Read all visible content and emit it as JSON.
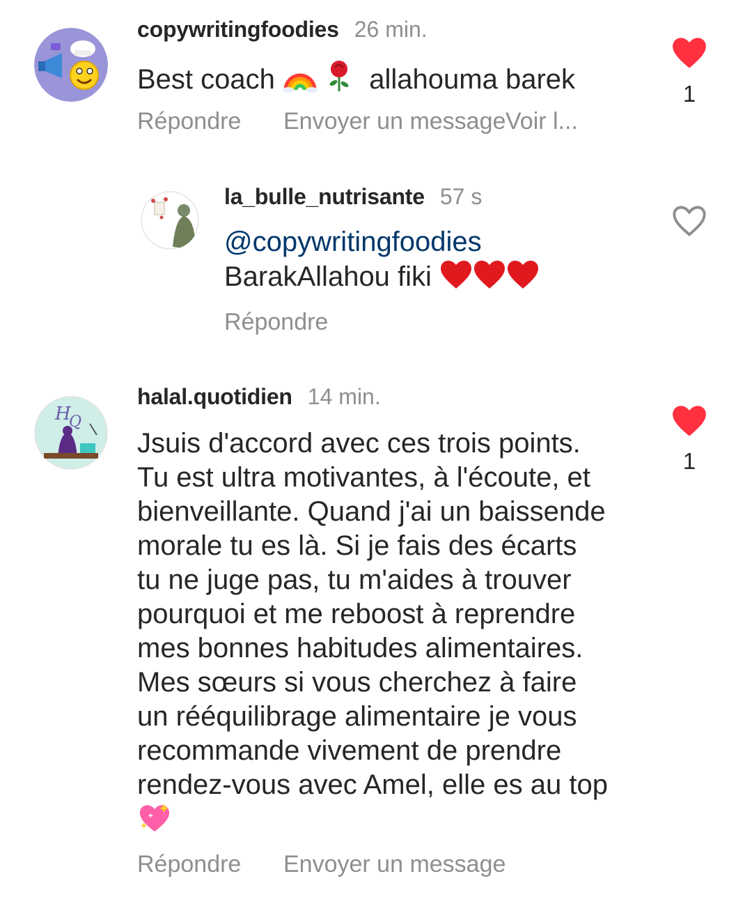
{
  "comments": [
    {
      "username": "copywritingfoodies",
      "time": "26 min.",
      "text": "Best coach",
      "text_after_emoji": "allahouma barek",
      "emojis": [
        "rainbow-emoji",
        "rose-emoji"
      ],
      "liked": true,
      "like_count": "1",
      "actions": [
        "Répondre",
        "Envoyer un message",
        "Voir l..."
      ]
    },
    {
      "username": "la_bulle_nutrisante",
      "time": "57 s",
      "mention": "@copywritingfoodies",
      "text": "BarakAllahou fiki",
      "emojis": [
        "red-heart-emoji",
        "red-heart-emoji",
        "red-heart-emoji"
      ],
      "liked": false,
      "actions": [
        "Répondre"
      ]
    },
    {
      "username": "halal.quotidien",
      "time": "14 min.",
      "text_lines": [
        "Jsuis d'accord avec ces trois points.",
        "Tu est ultra motivantes, à l'écoute, et",
        "bienveillante. Quand j'ai un baissende",
        "morale tu es là. Si je fais des écarts",
        "tu ne juge pas, tu m'aides à trouver",
        "pourquoi et me reboost à reprendre",
        "mes bonnes habitudes alimentaires.",
        "Mes sœurs si vous cherchez à faire",
        "un rééquilibrage alimentaire je vous",
        "recommande vivement de prendre",
        "rendez-vous avec Amel, elle es au top"
      ],
      "emojis": [
        "sparkling-heart-emoji"
      ],
      "liked": true,
      "like_count": "1",
      "actions": [
        "Répondre",
        "Envoyer un message"
      ]
    }
  ],
  "colors": {
    "like_red": "#ff3040",
    "secondary_text": "#8e8e8e",
    "mention": "#00376b"
  }
}
